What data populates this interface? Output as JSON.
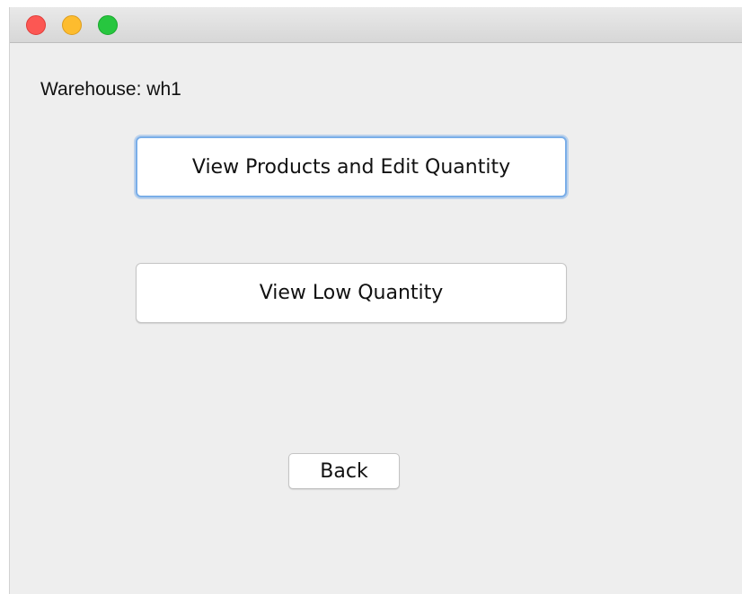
{
  "window": {
    "controls": [
      {
        "name": "close",
        "color": "#fc5753"
      },
      {
        "name": "minimize",
        "color": "#fdbc2e"
      },
      {
        "name": "zoom",
        "color": "#27c63f"
      }
    ]
  },
  "main": {
    "warehouse_label": "Warehouse: wh1",
    "view_products_label": "View Products and Edit Quantity",
    "view_low_quantity_label": "View Low Quantity",
    "back_label": "Back"
  },
  "colors": {
    "window_background": "#eeeeee",
    "button_background": "#ffffff",
    "focus_ring": "#7aaee8"
  }
}
